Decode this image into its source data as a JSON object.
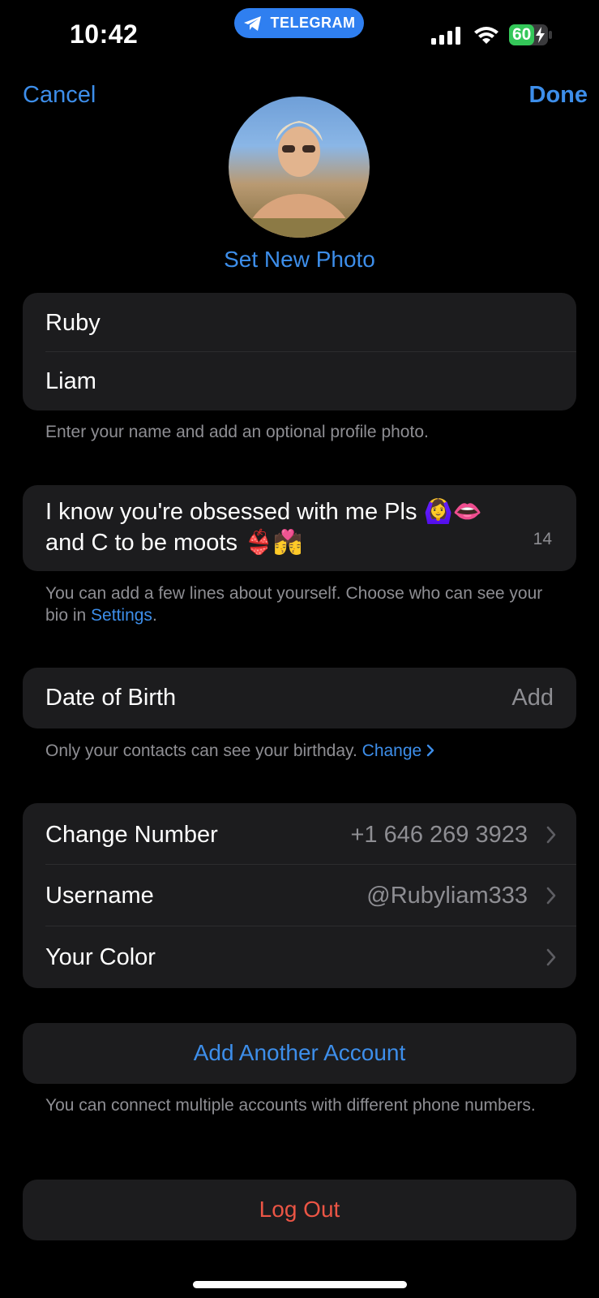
{
  "status_bar": {
    "time": "10:42",
    "app_pill": "TELEGRAM",
    "battery": "60"
  },
  "nav": {
    "cancel": "Cancel",
    "done": "Done"
  },
  "profile": {
    "set_photo": "Set New Photo",
    "first_name": "Ruby",
    "last_name": "Liam",
    "name_hint": "Enter your name and add an optional profile photo."
  },
  "bio": {
    "line1": "I know you're obsessed with me Pls 🙆‍♀️👄",
    "line2": "and C to be moots 👙💏",
    "counter": "14",
    "hint_prefix": "You can add a few lines about yourself. Choose who can see your bio in ",
    "hint_link": "Settings",
    "hint_suffix": "."
  },
  "birthday": {
    "label": "Date of Birth",
    "value": "Add",
    "hint": "Only your contacts can see your birthday.",
    "hint_link": "Change"
  },
  "account": {
    "change_number_label": "Change Number",
    "phone": "+1 646 269 3923",
    "username_label": "Username",
    "username": "@Rubyliam333",
    "color_label": "Your Color"
  },
  "add_account": {
    "label": "Add Another Account",
    "hint": "You can connect multiple accounts with different phone numbers."
  },
  "logout": {
    "label": "Log Out"
  },
  "colors": {
    "accent": "#3d8eea",
    "destructive": "#eb5545",
    "card": "#1c1c1e",
    "secondary_text": "#8e8e93"
  }
}
